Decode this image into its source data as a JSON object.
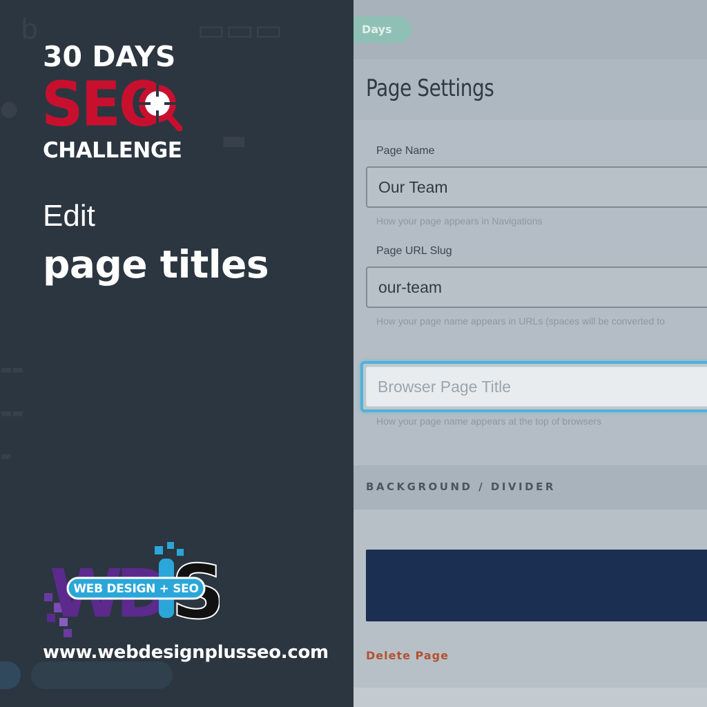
{
  "promo": {
    "line1": "30 DAYS",
    "line2": "SEO",
    "line3": "CHALLENGE",
    "heading_light": "Edit",
    "heading_bold": "page titles",
    "logo_text": "WEB DESIGN + SEO",
    "website": "www.webdesignplusseo.com"
  },
  "app": {
    "days_pill": "Days",
    "panel_title": "Page Settings",
    "fields": {
      "page_name": {
        "label": "Page Name",
        "value": "Our Team",
        "help": "How your page appears in Navigations"
      },
      "url_slug": {
        "label": "Page URL Slug",
        "value": "our-team",
        "help": "How your page name appears in URLs (spaces will be converted to"
      },
      "browser_title": {
        "placeholder": "Browser Page Title",
        "value": "",
        "help": "How your page name appears at the top of browsers"
      }
    },
    "section_title": "BACKGROUND / DIVIDER",
    "background_color": "#1b2f52",
    "delete_label": "Delete Page",
    "focus_color": "#4fb3d9"
  },
  "colors": {
    "left_panel": "#2c3640",
    "seo_red": "#c8102e",
    "logo_purple": "#5b2a8c",
    "logo_blue": "#2aa7d8"
  }
}
